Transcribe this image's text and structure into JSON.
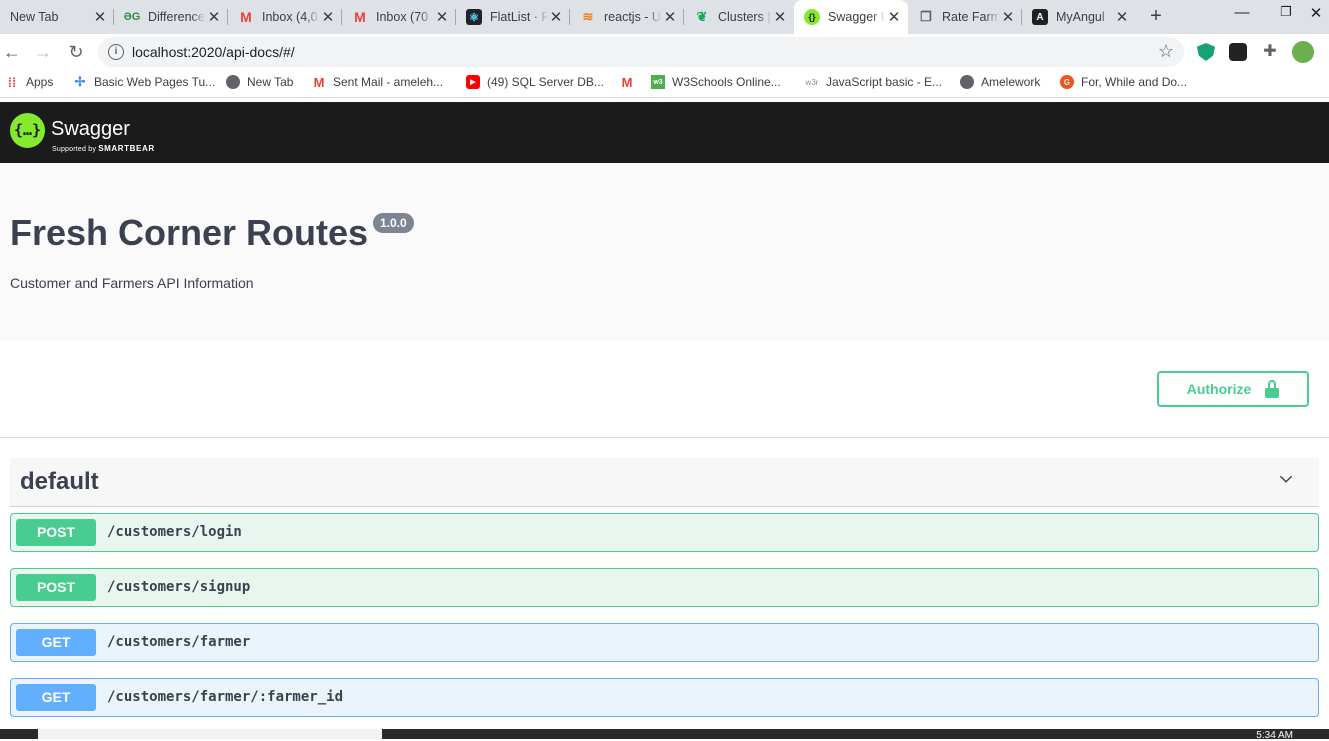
{
  "browser": {
    "tabs": [
      {
        "title": "New Tab",
        "icon": "none"
      },
      {
        "title": "Difference",
        "icon": "geeksforgeeks-icon",
        "color": "#2f8d46"
      },
      {
        "title": "Inbox (4,0",
        "icon": "gmail-icon",
        "color": "#ea4335"
      },
      {
        "title": "Inbox (70",
        "icon": "gmail-icon",
        "color": "#ea4335"
      },
      {
        "title": "FlatList · R",
        "icon": "react-native-icon",
        "color": "#20232a"
      },
      {
        "title": "reactjs - U",
        "icon": "stackoverflow-icon",
        "color": "#f48024"
      },
      {
        "title": "Clusters |",
        "icon": "mongodb-icon",
        "color": "#13aa52"
      },
      {
        "title": "Swagger UI",
        "icon": "swagger-icon",
        "color": "#85ea2d"
      },
      {
        "title": "Rate Farm",
        "icon": "page-icon",
        "color": "#5f6368"
      },
      {
        "title": "MyAngul",
        "icon": "angular-icon",
        "color": "#202124"
      }
    ],
    "url": "localhost:2020/api-docs/#/",
    "bookmarks": [
      {
        "label": "Apps",
        "icon": "apps-grid-icon",
        "color": "#ea4335"
      },
      {
        "label": "Basic Web Pages Tu...",
        "icon": "bookmark-icon",
        "color": "#4285f4"
      },
      {
        "label": "New Tab",
        "icon": "globe-icon",
        "color": "#5f6368"
      },
      {
        "label": "Sent Mail - ameleh...",
        "icon": "gmail-icon",
        "color": "#ea4335"
      },
      {
        "label": "(49) SQL Server DB...",
        "icon": "youtube-icon",
        "color": "#ff0000"
      },
      {
        "label": "",
        "icon": "gmail-icon",
        "color": "#ea4335"
      },
      {
        "label": "W3Schools Online...",
        "icon": "w3schools-icon",
        "color": "#4caf50"
      },
      {
        "label": "JavaScript basic - E...",
        "icon": "w3resource-icon",
        "color": "#888888"
      },
      {
        "label": "Amelework",
        "icon": "globe-icon",
        "color": "#5f6368"
      },
      {
        "label": "For, While and Do...",
        "icon": "guru99-icon",
        "color": "#f4511e"
      }
    ]
  },
  "swagger": {
    "brand": "Swagger",
    "supported_by": "Supported by",
    "smartbear": "SMARTBEAR",
    "title": "Fresh Corner Routes",
    "version": "1.0.0",
    "description": "Customer and Farmers API Information",
    "authorize_label": "Authorize",
    "section_name": "default",
    "operations": [
      {
        "method": "POST",
        "path": "/customers/login"
      },
      {
        "method": "POST",
        "path": "/customers/signup"
      },
      {
        "method": "GET",
        "path": "/customers/farmer"
      },
      {
        "method": "GET",
        "path": "/customers/farmer/:farmer_id"
      }
    ],
    "colors": {
      "post": "#49cc90",
      "get": "#61affe",
      "topbar": "#1b1b1b"
    }
  },
  "taskbar": {
    "clock": "5:34 AM"
  }
}
